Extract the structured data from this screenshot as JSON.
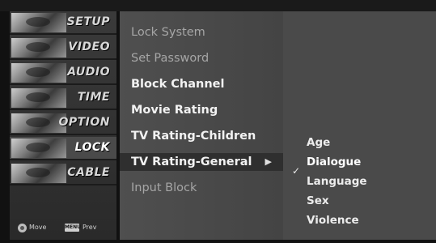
{
  "sidebar": {
    "items": [
      {
        "label": "SETUP",
        "icon": "setup-icon"
      },
      {
        "label": "VIDEO",
        "icon": "video-icon"
      },
      {
        "label": "AUDIO",
        "icon": "audio-icon"
      },
      {
        "label": "TIME",
        "icon": "time-icon"
      },
      {
        "label": "OPTION",
        "icon": "option-icon"
      },
      {
        "label": "LOCK",
        "icon": "lock-icon"
      },
      {
        "label": "CABLE",
        "icon": "cable-icon"
      }
    ],
    "active": "LOCK"
  },
  "legend": {
    "move_label": "Move",
    "menu_key": "MENU",
    "prev_label": "Prev"
  },
  "menu": {
    "items": [
      {
        "label": "Lock System"
      },
      {
        "label": "Set Password"
      },
      {
        "label": "Block Channel"
      },
      {
        "label": "Movie Rating"
      },
      {
        "label": "TV Rating-Children"
      },
      {
        "label": "TV Rating-General"
      },
      {
        "label": "Input Block"
      }
    ],
    "highlight_arrow": "▶"
  },
  "submenu": {
    "items": [
      {
        "label": "Age"
      },
      {
        "label": "Dialogue"
      },
      {
        "label": "Language"
      },
      {
        "label": "Sex"
      },
      {
        "label": "Violence"
      }
    ],
    "checkmark": "✓"
  }
}
